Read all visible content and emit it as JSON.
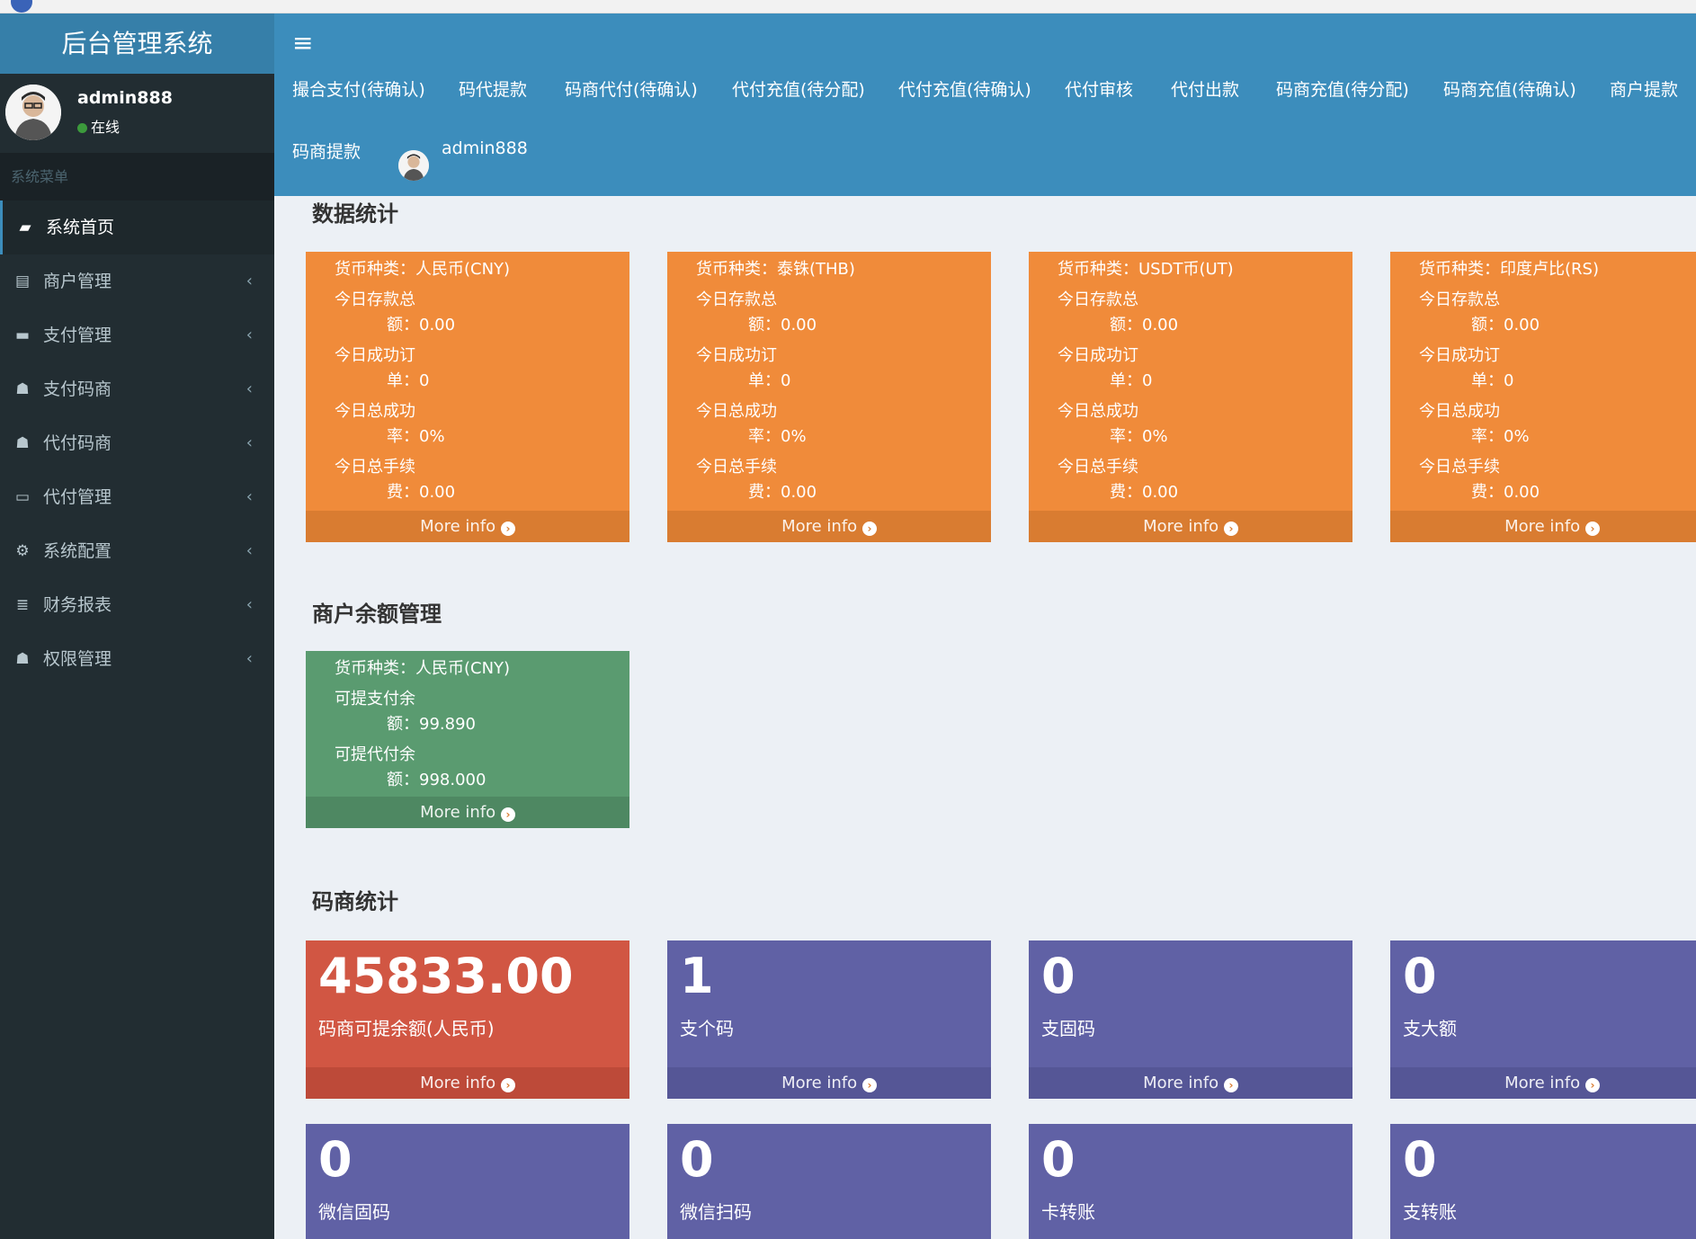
{
  "app": {
    "title": "后台管理系统"
  },
  "user": {
    "name": "admin888",
    "status": "在线"
  },
  "sidebar": {
    "header": "系统菜单",
    "items": [
      {
        "label": "系统首页",
        "icon": "book-icon",
        "glyph": "▰"
      },
      {
        "label": "商户管理",
        "icon": "id-card-icon",
        "glyph": "▤"
      },
      {
        "label": "支付管理",
        "icon": "credit-card-icon",
        "glyph": "▬"
      },
      {
        "label": "支付码商",
        "icon": "users-icon",
        "glyph": "☗"
      },
      {
        "label": "代付码商",
        "icon": "users-icon",
        "glyph": "☗"
      },
      {
        "label": "代付管理",
        "icon": "credit-card-icon",
        "glyph": "▭"
      },
      {
        "label": "系统配置",
        "icon": "cogs-icon",
        "glyph": "⚙"
      },
      {
        "label": "财务报表",
        "icon": "database-icon",
        "glyph": "≣"
      },
      {
        "label": "权限管理",
        "icon": "users-icon",
        "glyph": "☗"
      }
    ],
    "chevron": "‹"
  },
  "header": {
    "menu_toggle": "≡",
    "nav": [
      "撮合支付(待确认)",
      "码代提款",
      "码商代付(待确认)",
      "代付充值(待分配)",
      "代付充值(待确认)",
      "代付审核",
      "代付出款",
      "码商充值(待分配)",
      "码商充值(待确认)",
      "商户提款",
      "码商提款"
    ],
    "user": "admin888"
  },
  "sections": {
    "stats_title": "数据统计",
    "balance_title": "商户余额管理",
    "merchant_title": "码商统计"
  },
  "more_info": "More info",
  "stat_cards": [
    {
      "currency_label": "货币种类：",
      "currency": "人民币(CNY)",
      "rows": [
        [
          "今日存款总",
          "额：",
          "0.00"
        ],
        [
          "今日成功订",
          "单：",
          "0"
        ],
        [
          "今日总成功",
          "率：",
          "0%"
        ],
        [
          "今日总手续",
          "费：",
          "0.00"
        ]
      ]
    },
    {
      "currency_label": "货币种类：",
      "currency": "泰铢(THB)",
      "rows": [
        [
          "今日存款总",
          "额：",
          "0.00"
        ],
        [
          "今日成功订",
          "单：",
          "0"
        ],
        [
          "今日总成功",
          "率：",
          "0%"
        ],
        [
          "今日总手续",
          "费：",
          "0.00"
        ]
      ]
    },
    {
      "currency_label": "货币种类：",
      "currency": "USDT币(UT)",
      "rows": [
        [
          "今日存款总",
          "额：",
          "0.00"
        ],
        [
          "今日成功订",
          "单：",
          "0"
        ],
        [
          "今日总成功",
          "率：",
          "0%"
        ],
        [
          "今日总手续",
          "费：",
          "0.00"
        ]
      ]
    },
    {
      "currency_label": "货币种类：",
      "currency": "印度卢比(RS)",
      "rows": [
        [
          "今日存款总",
          "额：",
          "0.00"
        ],
        [
          "今日成功订",
          "单：",
          "0"
        ],
        [
          "今日总成功",
          "率：",
          "0%"
        ],
        [
          "今日总手续",
          "费：",
          "0.00"
        ]
      ]
    }
  ],
  "balance_card": {
    "currency_label": "货币种类：",
    "currency": "人民币(CNY)",
    "rows": [
      [
        "可提支付余",
        "额：",
        "99.890"
      ],
      [
        "可提代付余",
        "额：",
        "998.000"
      ]
    ]
  },
  "merchant_cards": [
    {
      "value": "45833.00",
      "label": "码商可提余额(人民币)",
      "color": "red"
    },
    {
      "value": "1",
      "label": "支个码",
      "color": "purple"
    },
    {
      "value": "0",
      "label": "支固码",
      "color": "purple"
    },
    {
      "value": "0",
      "label": "支大额",
      "color": "purple"
    },
    {
      "value": "0",
      "label": "微信固码",
      "color": "purple"
    },
    {
      "value": "0",
      "label": "微信扫码",
      "color": "purple"
    },
    {
      "value": "0",
      "label": "卡转账",
      "color": "purple"
    },
    {
      "value": "0",
      "label": "支转账",
      "color": "purple"
    }
  ],
  "colors": {
    "sidebar": "#222d32",
    "header": "#3c8dbc",
    "logo": "#367fa9",
    "orange": "#f08b3a",
    "green": "#5a9b70",
    "red": "#d15643",
    "purple": "#6061a5"
  }
}
